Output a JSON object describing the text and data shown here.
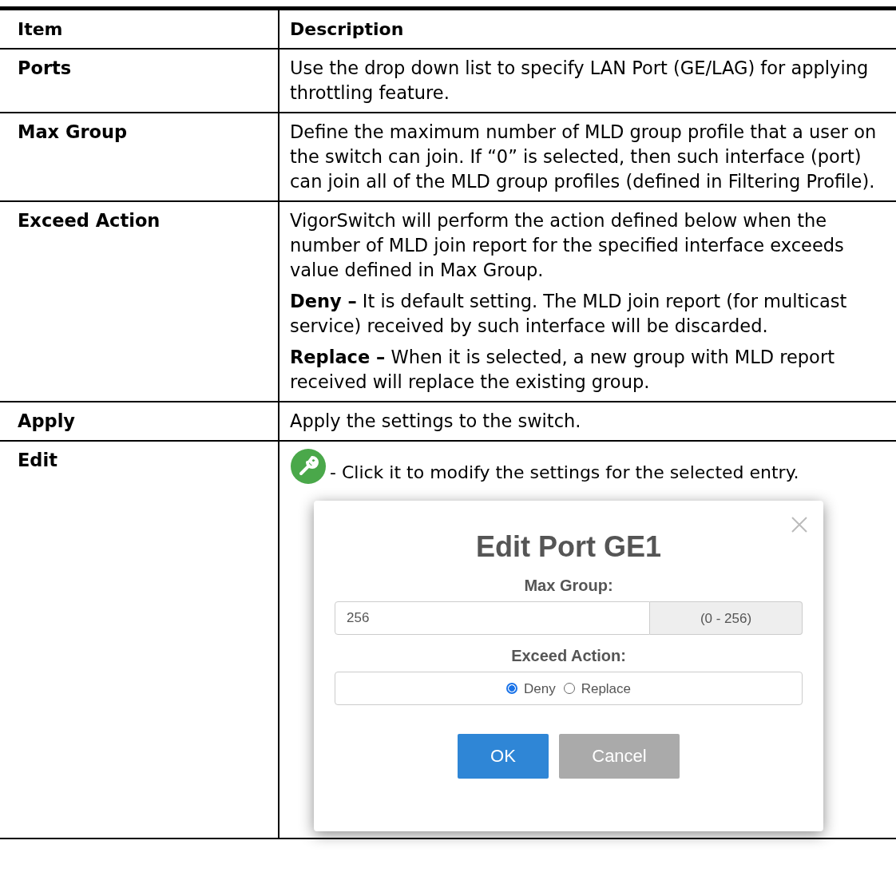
{
  "table": {
    "columns": [
      "Item",
      "Description"
    ],
    "rows": [
      {
        "item": "Ports",
        "paragraphs": [
          "Use the drop down list to specify LAN Port (GE/LAG) for applying throttling feature."
        ]
      },
      {
        "item": "Max Group",
        "paragraphs": [
          "Define the maximum number of MLD group profile that a user on the switch can join. If “0” is selected, then such interface (port) can join all of the MLD group profiles (defined in Filtering Profile)."
        ]
      },
      {
        "item": "Exceed Action",
        "paragraphs": [
          "VigorSwitch will perform the action defined below when the number of MLD join report for the specified interface exceeds value defined in Max Group.",
          "**Deny –** It is default setting. The MLD join report (for multicast service) received by such interface will be discarded.",
          "**Replace –** When it is selected, a new group with MLD report received will replace the existing group."
        ]
      },
      {
        "item": "Apply",
        "paragraphs": [
          "Apply the settings to the switch."
        ]
      },
      {
        "item": "Edit",
        "icon_note": "- Click it to modify the settings for the selected entry.",
        "dialog": {
          "title": "Edit Port GE1",
          "max_group_label": "Max Group:",
          "max_group_value": "256",
          "max_group_range": "(0 - 256)",
          "exceed_label": "Exceed Action:",
          "options": [
            {
              "label": "Deny",
              "selected": true
            },
            {
              "label": "Replace",
              "selected": false
            }
          ],
          "buttons": [
            {
              "label": "OK",
              "kind": "primary"
            },
            {
              "label": "Cancel",
              "kind": "secondary"
            }
          ]
        }
      }
    ]
  }
}
